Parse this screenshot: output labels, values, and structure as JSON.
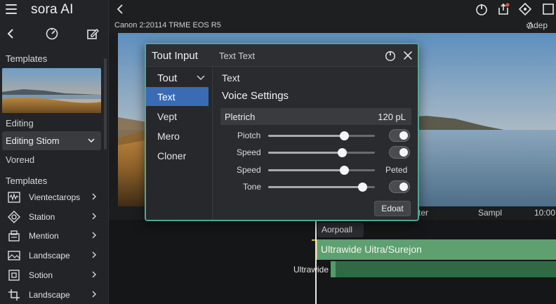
{
  "app": {
    "brand": "sora AI"
  },
  "sidebar": {
    "templates_title": "Templates",
    "editing_label": "Editing",
    "select_value": "Editing Stiom",
    "voreed_label": "Voreнd",
    "templates_title_2": "Templates",
    "items": [
      {
        "label": "Vientectarops",
        "icon": "waveform-icon"
      },
      {
        "label": "Station",
        "icon": "station-icon"
      },
      {
        "label": "Mention",
        "icon": "mention-icon"
      },
      {
        "label": "Landscape",
        "icon": "landscape-icon"
      },
      {
        "label": "Sotion",
        "icon": "sotion-icon"
      },
      {
        "label": "Landscape",
        "icon": "crop-icon"
      }
    ]
  },
  "subhead": {
    "camera": "Canon 2:20114 TRME EOS R5",
    "adep": "Adep"
  },
  "preview_bar": {
    "left": "ter",
    "mid": "Sampl",
    "right": "10:00"
  },
  "timeline": {
    "clip_label": "Aorpoall",
    "track_a": "Ultrawide Uitra/Surejon",
    "track_b": "Ultrawide"
  },
  "dialog": {
    "title": "Tout Input",
    "subtitle": "Text Text",
    "nav_head": "Tout",
    "nav_items": [
      {
        "label": "Text",
        "selected": true
      },
      {
        "label": "Vept",
        "selected": false
      },
      {
        "label": "Mero",
        "selected": false
      },
      {
        "label": "Cloner",
        "selected": false
      }
    ],
    "body_text": "Text",
    "body_heading": "Voice Settings",
    "pitch_label": "Pletrich",
    "pitch_value": "120 pL",
    "controls": [
      {
        "label": "Piotch",
        "level": 0.71,
        "toggle": true
      },
      {
        "label": "Speed",
        "level": 0.69,
        "toggle": true
      },
      {
        "label": "Speed",
        "level": 0.71,
        "value_text": "Peted"
      },
      {
        "label": "Tone",
        "level": 0.88,
        "toggle": true
      }
    ],
    "edit_button": "Edoat"
  },
  "colors": {
    "accent_border": "#4ea795",
    "nav_selected": "#3a6bb5",
    "track_green": "#5ea06f",
    "track_edge": "#d8b23a"
  }
}
